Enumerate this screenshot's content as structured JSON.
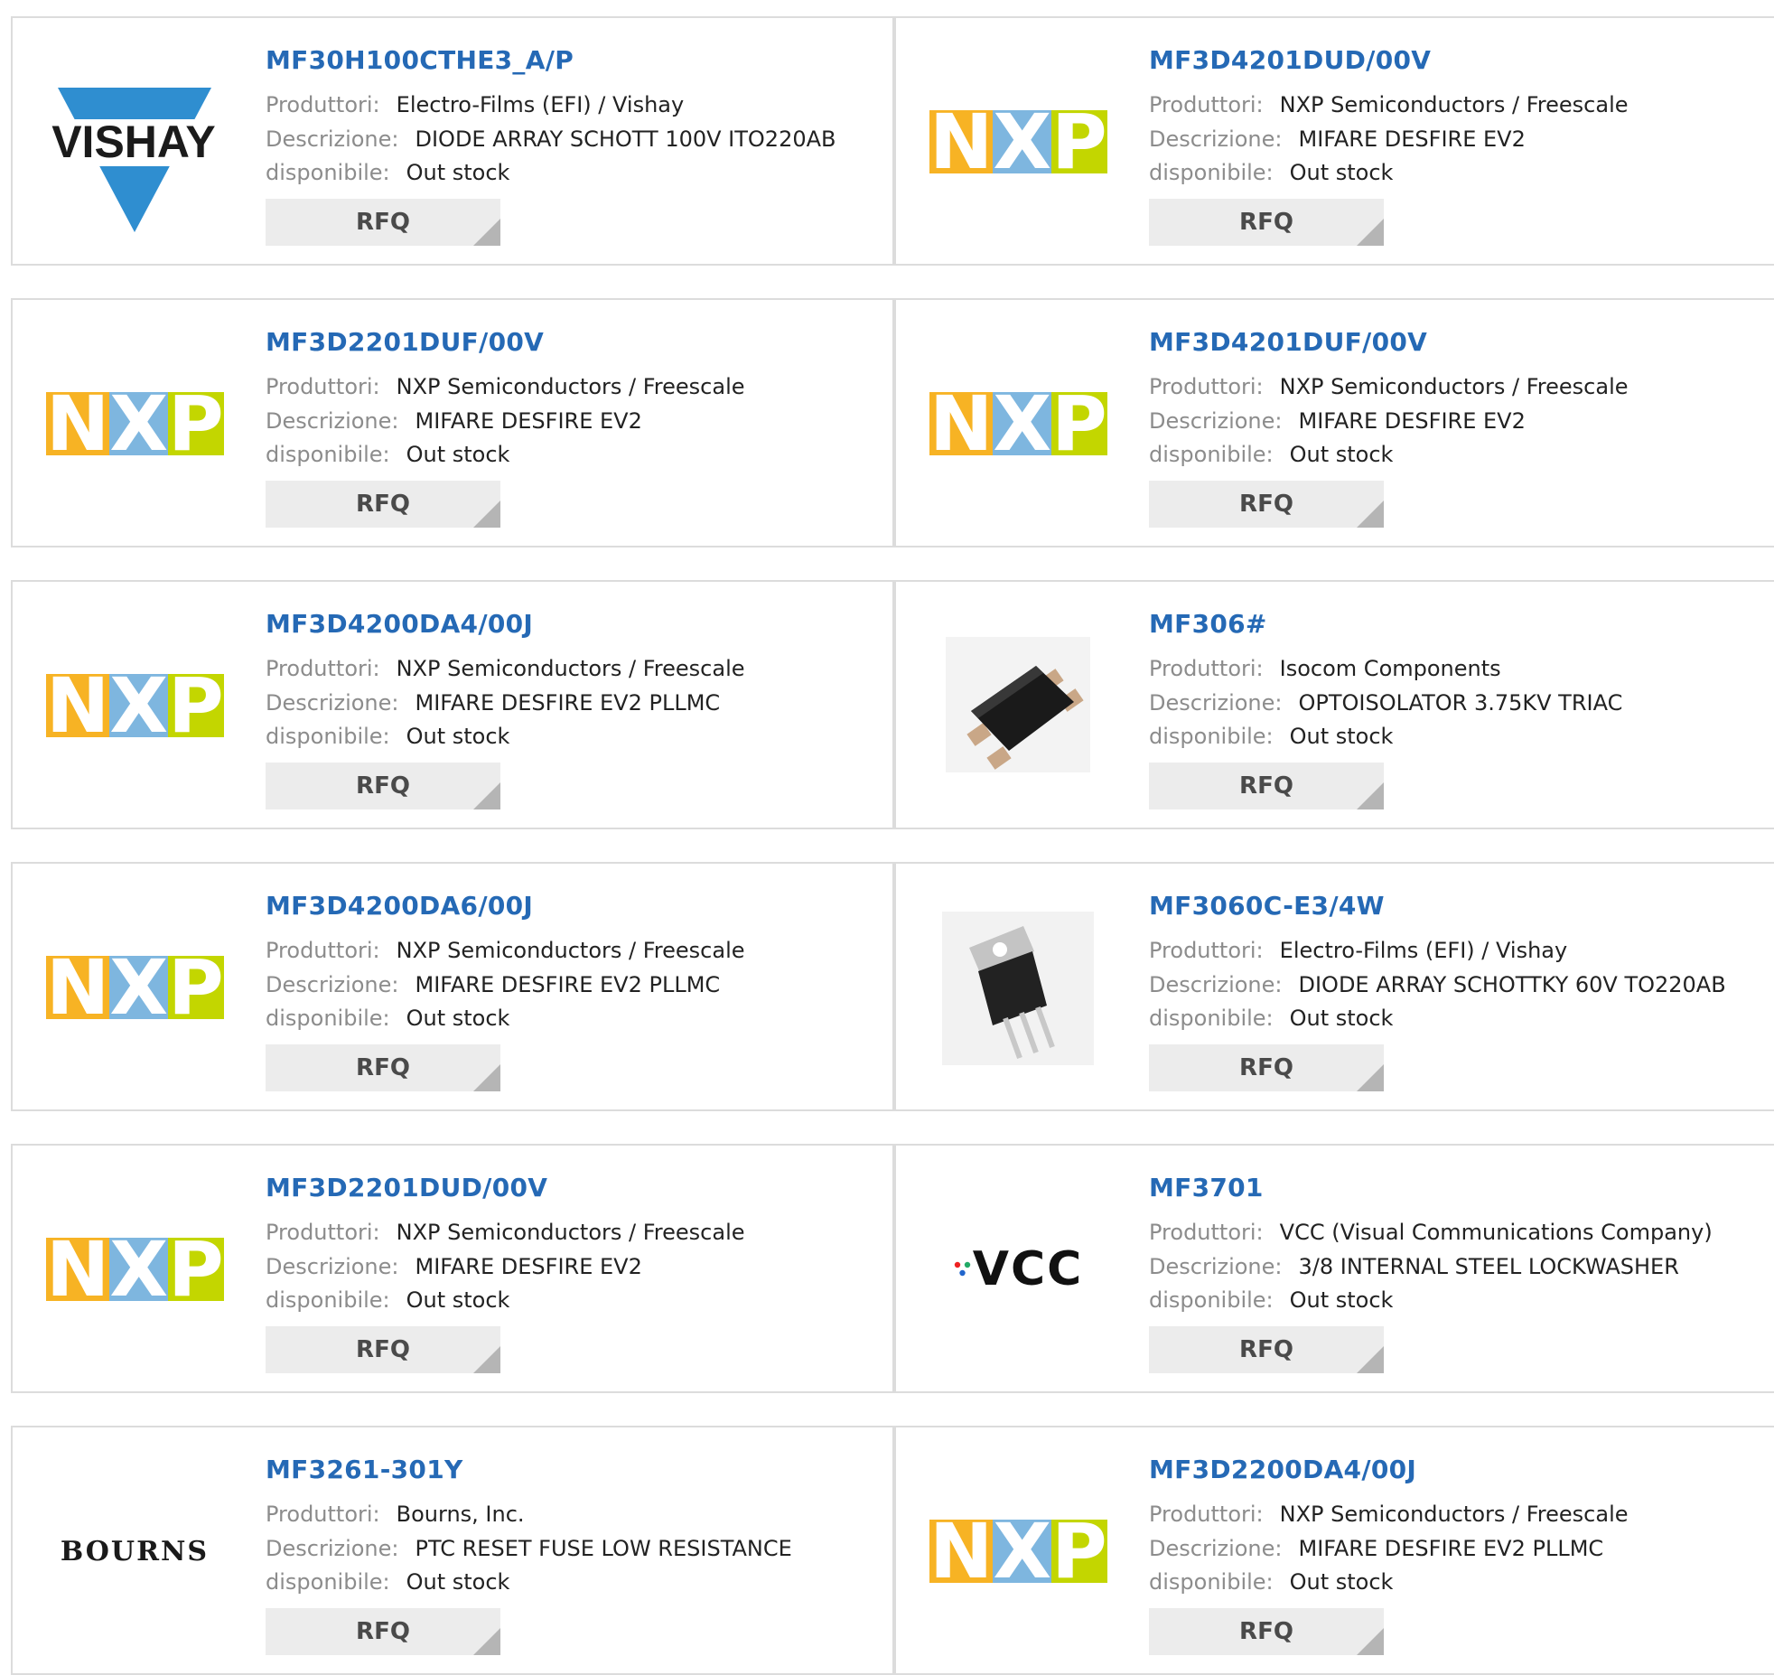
{
  "labels": {
    "manufacturer": "Produttori:",
    "description": "Descrizione:",
    "availability": "disponibile:",
    "rfq": "RFQ"
  },
  "brand_colors": {
    "nxp": [
      "#f7b324",
      "#7eb6df",
      "#c3d600"
    ],
    "vishay": "#2f8ed0",
    "link": "#2569b5"
  },
  "products": [
    {
      "part": "MF30H100CTHE3_A/P",
      "manufacturer": "Electro-Films (EFI) / Vishay",
      "description": "DIODE ARRAY SCHOTT 100V ITO220AB",
      "availability": "Out stock",
      "logo": "vishay",
      "logo_text": "VISHAY"
    },
    {
      "part": "MF3D4201DUD/00V",
      "manufacturer": "NXP Semiconductors / Freescale",
      "description": "MIFARE DESFIRE EV2",
      "availability": "Out stock",
      "logo": "nxp",
      "logo_text": "NXP"
    },
    {
      "part": "MF3D2201DUF/00V",
      "manufacturer": "NXP Semiconductors / Freescale",
      "description": "MIFARE DESFIRE EV2",
      "availability": "Out stock",
      "logo": "nxp",
      "logo_text": "NXP"
    },
    {
      "part": "MF3D4201DUF/00V",
      "manufacturer": "NXP Semiconductors / Freescale",
      "description": "MIFARE DESFIRE EV2",
      "availability": "Out stock",
      "logo": "nxp",
      "logo_text": "NXP"
    },
    {
      "part": "MF3D4200DA4/00J",
      "manufacturer": "NXP Semiconductors / Freescale",
      "description": "MIFARE DESFIRE EV2 PLLMC",
      "availability": "Out stock",
      "logo": "nxp",
      "logo_text": "NXP"
    },
    {
      "part": "MF306#",
      "manufacturer": "Isocom Components",
      "description": "OPTOISOLATOR 3.75KV TRIAC",
      "availability": "Out stock",
      "logo": "smd-chip-photo"
    },
    {
      "part": "MF3D4200DA6/00J",
      "manufacturer": "NXP Semiconductors / Freescale",
      "description": "MIFARE DESFIRE EV2 PLLMC",
      "availability": "Out stock",
      "logo": "nxp",
      "logo_text": "NXP"
    },
    {
      "part": "MF3060C-E3/4W",
      "manufacturer": "Electro-Films (EFI) / Vishay",
      "description": "DIODE ARRAY SCHOTTKY 60V TO220AB",
      "availability": "Out stock",
      "logo": "to220-photo"
    },
    {
      "part": "MF3D2201DUD/00V",
      "manufacturer": "NXP Semiconductors / Freescale",
      "description": "MIFARE DESFIRE EV2",
      "availability": "Out stock",
      "logo": "nxp",
      "logo_text": "NXP"
    },
    {
      "part": "MF3701",
      "manufacturer": "VCC (Visual Communications Company)",
      "description": "3/8 INTERNAL STEEL LOCKWASHER",
      "availability": "Out stock",
      "logo": "vcc",
      "logo_text": "VCC"
    },
    {
      "part": "MF3261-301Y",
      "manufacturer": "Bourns, Inc.",
      "description": "PTC RESET FUSE LOW RESISTANCE",
      "availability": "Out stock",
      "logo": "bourns",
      "logo_text": "BOURNS"
    },
    {
      "part": "MF3D2200DA4/00J",
      "manufacturer": "NXP Semiconductors / Freescale",
      "description": "MIFARE DESFIRE EV2 PLLMC",
      "availability": "Out stock",
      "logo": "nxp",
      "logo_text": "NXP"
    }
  ]
}
